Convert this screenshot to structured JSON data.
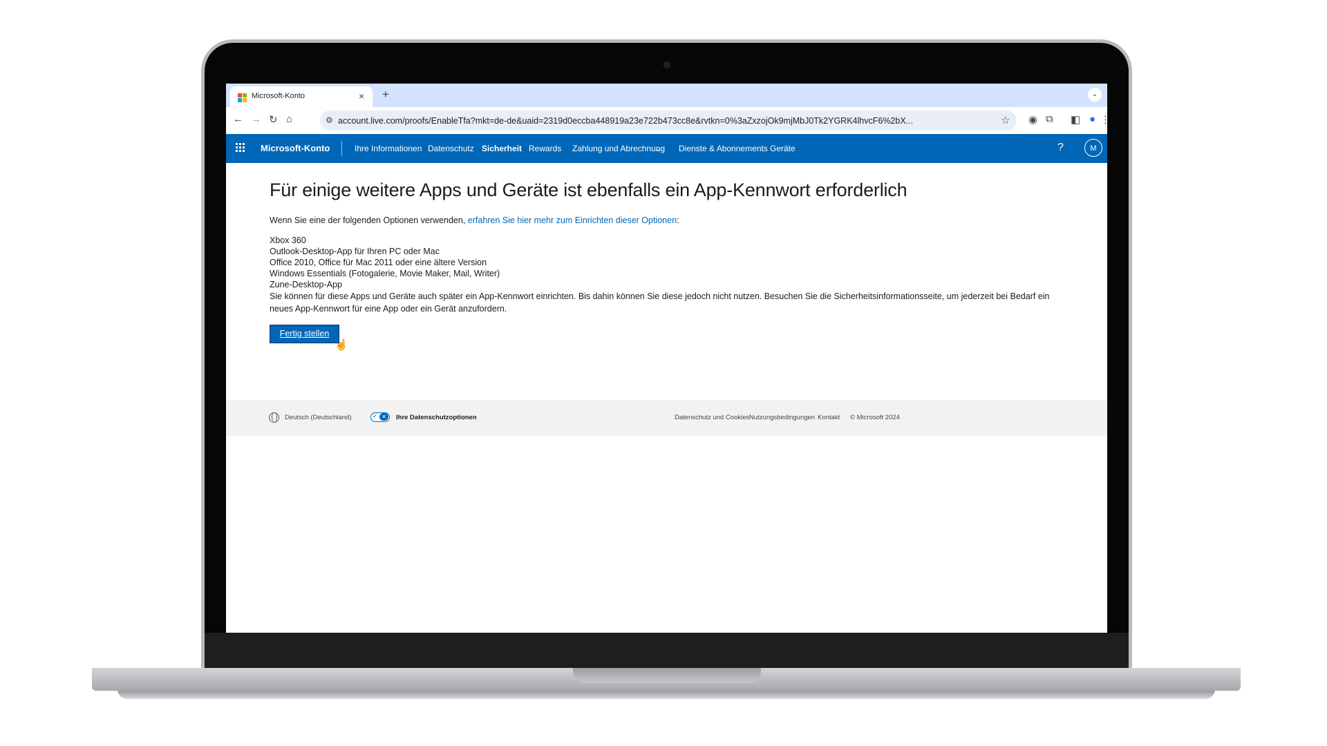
{
  "browser": {
    "tab_title": "Microsoft-Konto",
    "tab_close": "×",
    "new_tab": "+",
    "tab_menu": "⌄",
    "url": "account.live.com/proofs/EnableTfa?mkt=de-de&uaid=2319d0eccba448919a23e722b473cc8e&rvtkn=0%3aZxzojOk9mjMbJ0Tk2YGRK4lhvcF6%2bX..."
  },
  "nav": {
    "brand": "Microsoft-Konto",
    "items": [
      {
        "label": "Ihre Informationen"
      },
      {
        "label": "Datenschutz"
      },
      {
        "label": "Sicherheit"
      },
      {
        "label": "Rewards"
      },
      {
        "label": "Zahlung und Abrechnung"
      },
      {
        "label": "Dienste & Abonnements"
      },
      {
        "label": "Geräte"
      }
    ],
    "help": "?",
    "avatar": "M"
  },
  "main": {
    "heading": "Für einige weitere Apps und Geräte ist ebenfalls ein App-Kennwort erforderlich",
    "intro_text": "Wenn Sie eine der folgenden Optionen verwenden, ",
    "intro_link": "erfahren Sie hier mehr zum Einrichten dieser Optionen",
    "intro_end": ":",
    "apps": [
      "Xbox 360",
      "Outlook-Desktop-App für Ihren PC oder Mac",
      "Office 2010, Office für Mac 2011 oder eine ältere Version",
      "Windows Essentials (Fotogalerie, Movie Maker, Mail, Writer)",
      "Zune-Desktop-App"
    ],
    "paragraph": "Sie können für diese Apps und Geräte auch später ein App-Kennwort einrichten. Bis dahin können Sie diese jedoch nicht nutzen. Besuchen Sie die Sicherheitsinformationsseite, um jederzeit bei Bedarf ein neues App-Kennwort für eine App oder ein Gerät anzufordern.",
    "finish_button": "Fertig stellen"
  },
  "footer": {
    "language": "Deutsch (Deutschland)",
    "privacy_choices": "Ihre Datenschutzoptionen",
    "links": [
      "Datenschutz und Cookies",
      "Nutzungsbedingungen",
      "Kontakt"
    ],
    "copyright": "© Microsoft 2024"
  },
  "colors": {
    "accent": "#0067b8",
    "tab_bar": "#d3e3fd",
    "footer_bg": "#f2f2f2"
  }
}
